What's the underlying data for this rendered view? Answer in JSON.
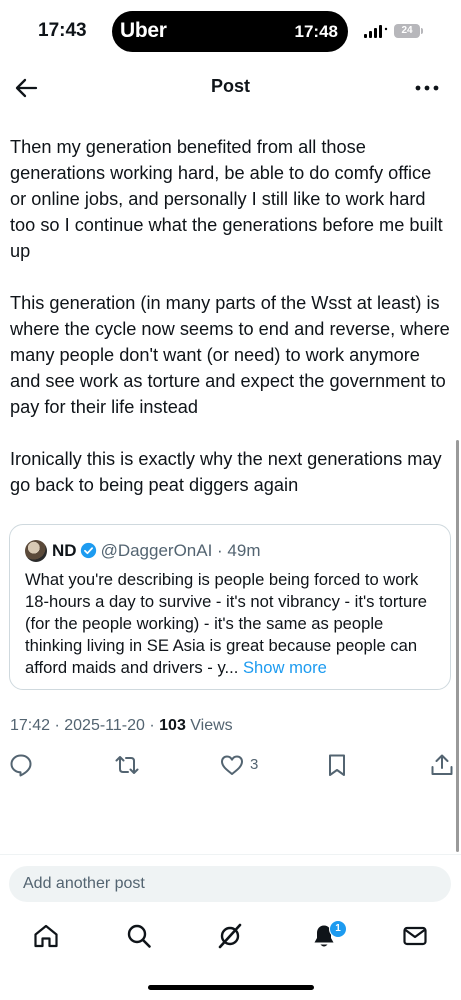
{
  "status_bar": {
    "time": "17:43",
    "island_app": "Uber",
    "island_time": "17:48",
    "battery": "24"
  },
  "header": {
    "title": "Post",
    "back_icon": "arrow-left-icon",
    "more_icon": "ellipsis-icon"
  },
  "post": {
    "paragraphs": [
      "Then my generation benefited from all those generations working hard, be able to do comfy office or online jobs, and personally I still like to work hard too so I continue what the generations before me built up",
      "This generation (in many parts of the Wsst at least) is where the cycle now seems to end and reverse, where many people don't want (or need) to work anymore and see work as torture and expect the government to pay for their life instead",
      "Ironically this is exactly why the next generations may go back to being peat diggers again"
    ],
    "timestamp": "17:42 · 2025-11-20 · ",
    "views_count": "103",
    "views_label": " Views"
  },
  "quote": {
    "name": "ND",
    "handle": "@DaggerOnAI",
    "age": " · 49m",
    "text": "What you're describing is people being forced to work 18-hours a day to survive - it's not vibrancy - it's torture (for the people working) - it's the same as people thinking living in SE Asia is great because people can afford maids and drivers - y...",
    "show_more": " Show more"
  },
  "actions": {
    "like_count": "3"
  },
  "reply": {
    "placeholder": "Add another post"
  },
  "nav": {
    "notifications_badge": "1"
  },
  "colors": {
    "accent": "#1d9bf0",
    "text": "#0f1419",
    "secondary_text": "#536471",
    "border": "#cfd9de"
  }
}
